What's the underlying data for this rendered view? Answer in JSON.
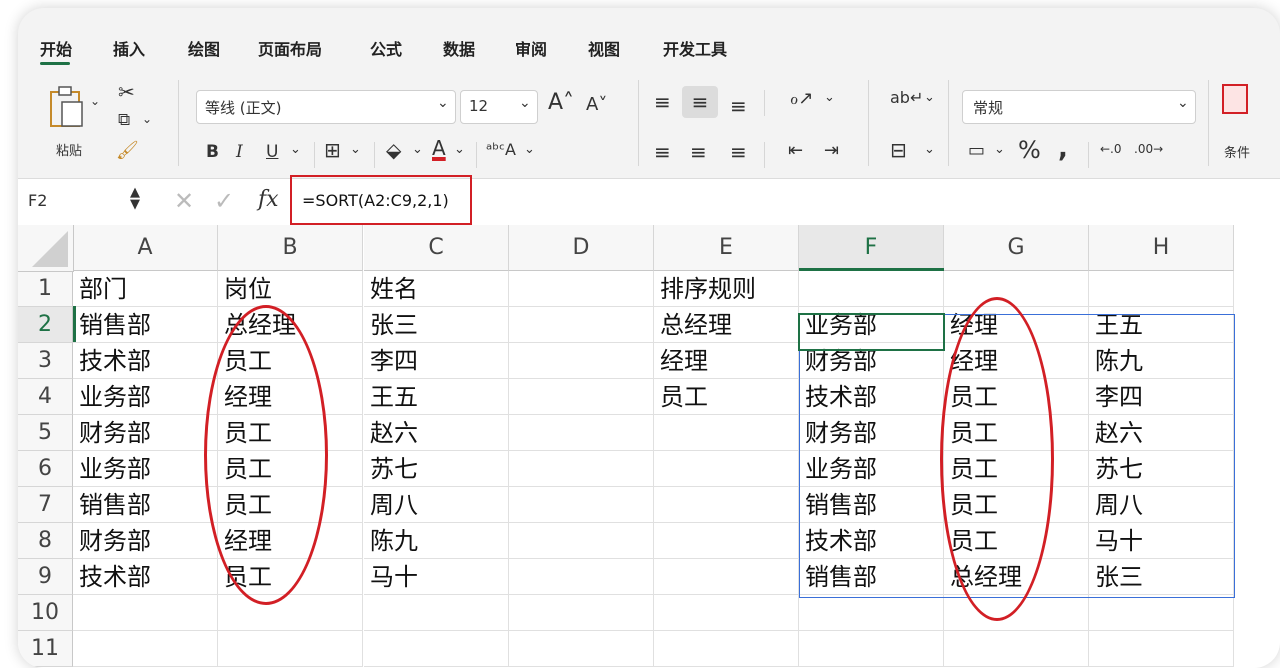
{
  "tabs": [
    "开始",
    "插入",
    "绘图",
    "页面布局",
    "公式",
    "数据",
    "审阅",
    "视图",
    "开发工具"
  ],
  "ribbon": {
    "paste_label": "粘贴",
    "font_name": "等线 (正文)",
    "font_size": "12",
    "number_format": "常规",
    "conditional_label": "条件"
  },
  "formula_bar": {
    "name_box": "F2",
    "fx": "fx",
    "formula": "=SORT(A2:C9,2,1)"
  },
  "columns": [
    "A",
    "B",
    "C",
    "D",
    "E",
    "F",
    "G",
    "H"
  ],
  "rows": [
    "1",
    "2",
    "3",
    "4",
    "5",
    "6",
    "7",
    "8",
    "9",
    "10",
    "11"
  ],
  "cells": {
    "A": [
      "部门",
      "销售部",
      "技术部",
      "业务部",
      "财务部",
      "业务部",
      "销售部",
      "财务部",
      "技术部"
    ],
    "B": [
      "岗位",
      "总经理",
      "员工",
      "经理",
      "员工",
      "员工",
      "员工",
      "经理",
      "员工"
    ],
    "C": [
      "姓名",
      "张三",
      "李四",
      "王五",
      "赵六",
      "苏七",
      "周八",
      "陈九",
      "马十"
    ],
    "E": [
      "排序规则",
      "总经理",
      "经理",
      "员工"
    ],
    "F": [
      "",
      "业务部",
      "财务部",
      "技术部",
      "财务部",
      "业务部",
      "销售部",
      "技术部",
      "销售部"
    ],
    "G": [
      "",
      "经理",
      "经理",
      "员工",
      "员工",
      "员工",
      "员工",
      "员工",
      "总经理"
    ],
    "H": [
      "",
      "王五",
      "陈九",
      "李四",
      "赵六",
      "苏七",
      "周八",
      "马十",
      "张三"
    ]
  },
  "colors": {
    "accent_green": "#1e7145",
    "highlight_red": "#d21f25",
    "spill_blue": "#3a6fd8"
  }
}
